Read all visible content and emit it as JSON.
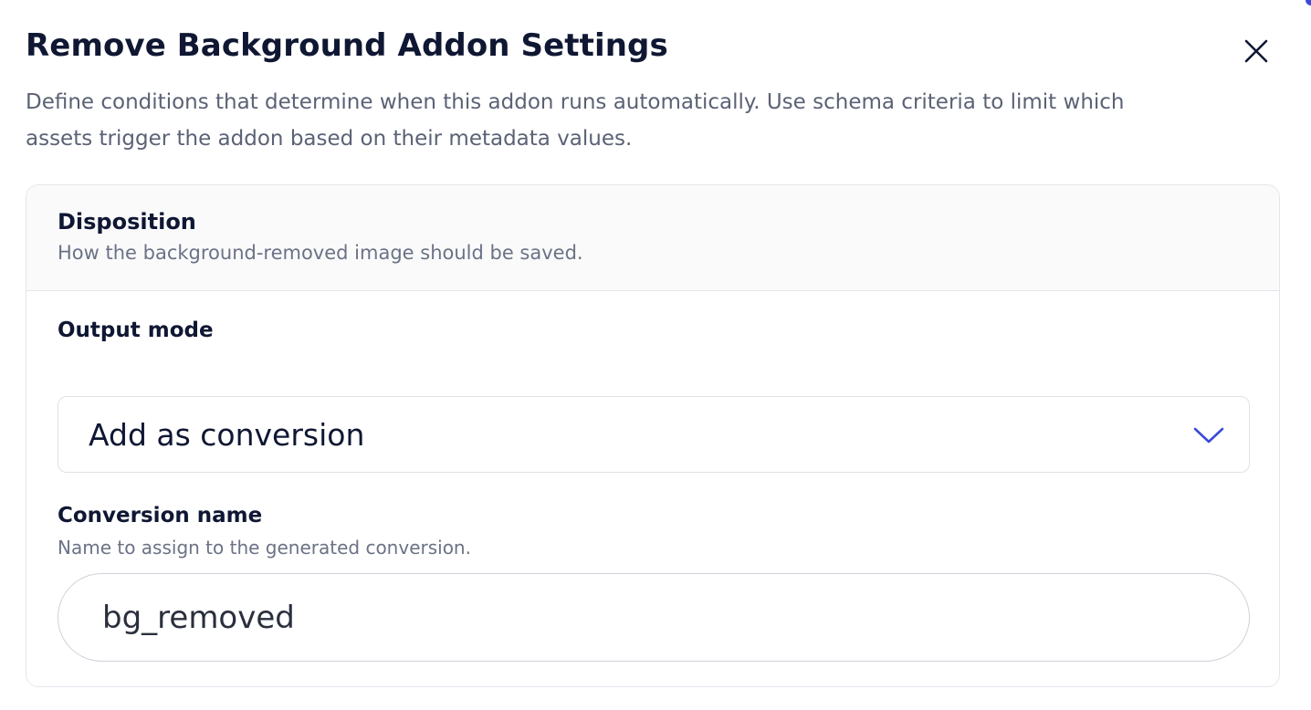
{
  "dialog": {
    "title": "Remove Background Addon Settings",
    "description": "Define conditions that determine when this addon runs automatically. Use schema criteria to limit which assets trigger the addon based on their metadata values.",
    "close_icon": "close-icon"
  },
  "disposition": {
    "title": "Disposition",
    "subtitle": "How the background-removed image should be saved."
  },
  "output_mode": {
    "label": "Output mode",
    "selected": "Add as conversion",
    "chevron_icon": "chevron-down-icon"
  },
  "conversion_name": {
    "label": "Conversion name",
    "help": "Name to assign to the generated conversion.",
    "value": "bg_removed"
  },
  "colors": {
    "text_primary": "#0f1733",
    "text_secondary": "#5b6275",
    "accent": "#3a4bd6",
    "border": "#e4e6ec",
    "header_bg": "#fafafb"
  }
}
